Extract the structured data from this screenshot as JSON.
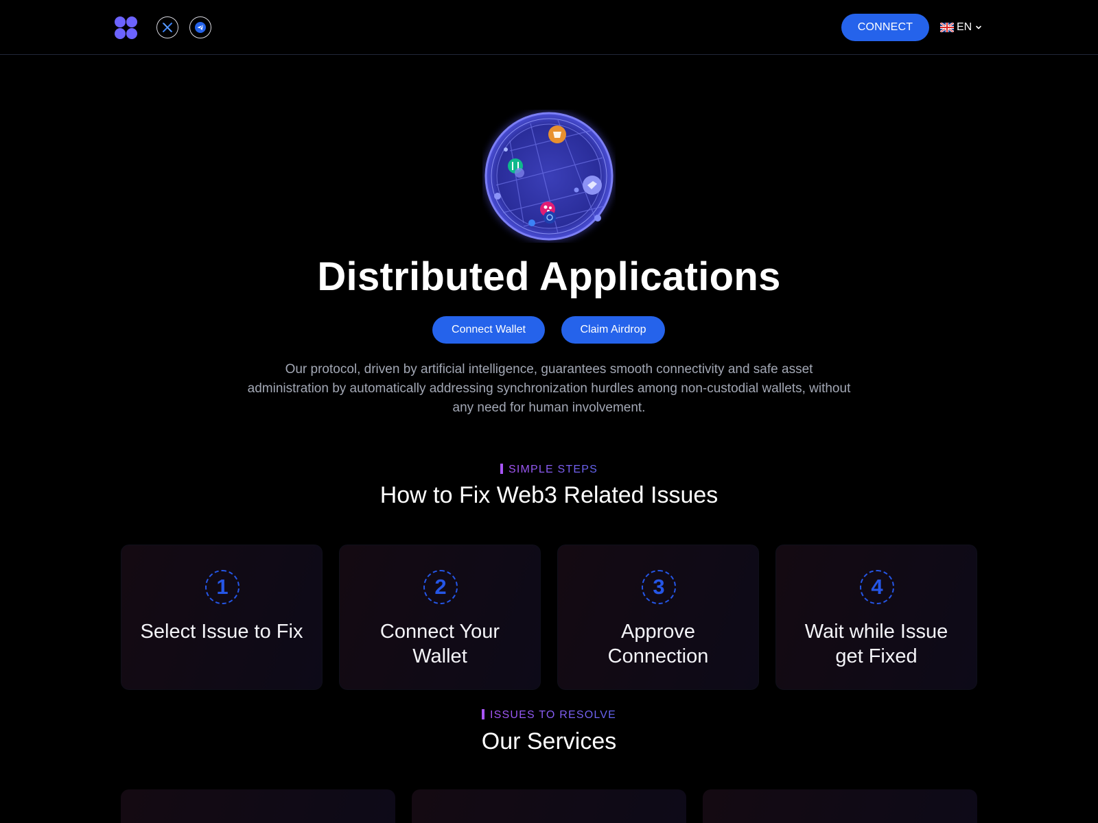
{
  "header": {
    "logo": "logo-icon",
    "social": [
      {
        "name": "x",
        "icon": "x-icon"
      },
      {
        "name": "telegram",
        "icon": "telegram-icon"
      }
    ],
    "connect_label": "CONNECT",
    "language": {
      "flag": "uk-flag-icon",
      "code": "EN"
    }
  },
  "hero": {
    "title": "Distributed Applications",
    "buttons": {
      "connect_wallet": "Connect Wallet",
      "claim_airdrop": "Claim Airdrop"
    },
    "description": "Our protocol, driven by artificial intelligence, guarantees smooth connectivity and safe asset administration by automatically addressing synchronization hurdles among non-custodial wallets, without any need for human involvement."
  },
  "steps_section": {
    "eyebrow": "SIMPLE STEPS",
    "title": "How to Fix Web3 Related Issues",
    "steps": [
      {
        "number": "1",
        "label": "Select Issue to Fix"
      },
      {
        "number": "2",
        "label": "Connect Your Wallet"
      },
      {
        "number": "3",
        "label": "Approve Connection"
      },
      {
        "number": "4",
        "label": "Wait while Issue get Fixed"
      }
    ]
  },
  "services_section": {
    "eyebrow": "ISSUES TO RESOLVE",
    "title": "Our Services"
  },
  "colors": {
    "accent": "#2563eb",
    "logo": "#6c63ff",
    "eyebrow": "#8b5cf6",
    "muted_text": "#a3a8b5"
  }
}
